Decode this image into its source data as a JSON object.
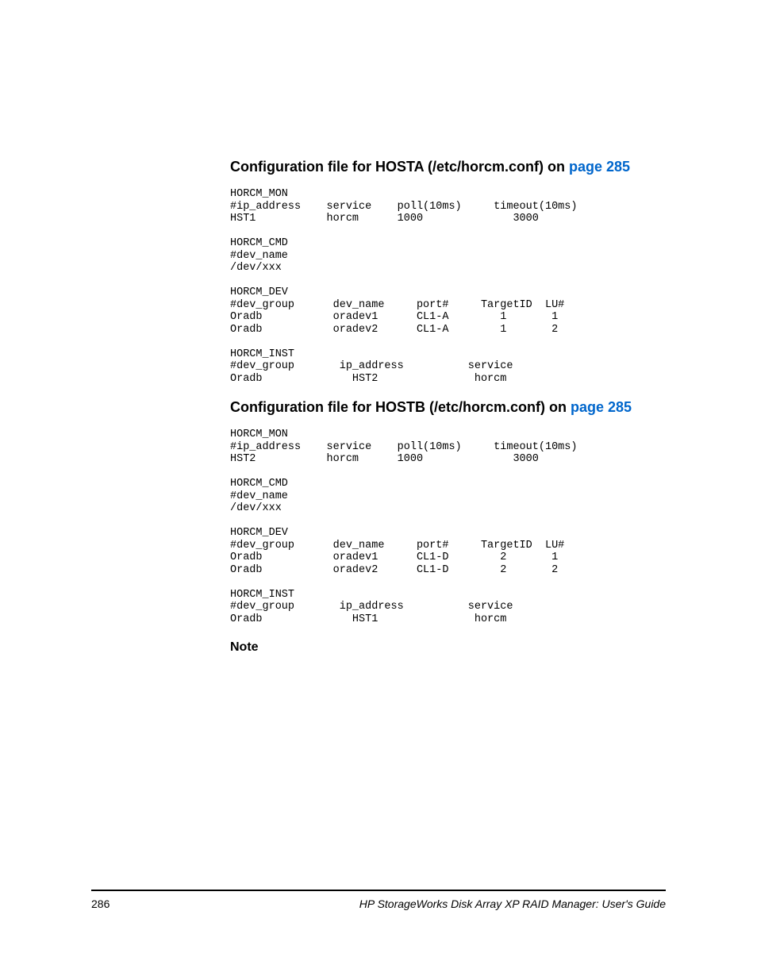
{
  "sectionA": {
    "title_prefix": "Configuration file for HOSTA (/etc/horcm.conf) on ",
    "title_link": "page 285",
    "block": "HORCM_MON\n#ip_address    service    poll(10ms)     timeout(10ms)\nHST1           horcm      1000              3000\n\nHORCM_CMD\n#dev_name\n/dev/xxx\n\nHORCM_DEV\n#dev_group      dev_name     port#     TargetID  LU#\nOradb           oradev1      CL1-A        1       1\nOradb           oradev2      CL1-A        1       2\n\nHORCM_INST\n#dev_group       ip_address          service\nOradb              HST2               horcm"
  },
  "sectionB": {
    "title_prefix": "Configuration file for HOSTB (/etc/horcm.conf) on ",
    "title_link": "page 285",
    "block": "HORCM_MON\n#ip_address    service    poll(10ms)     timeout(10ms)\nHST2           horcm      1000              3000\n\nHORCM_CMD\n#dev_name\n/dev/xxx\n\nHORCM_DEV\n#dev_group      dev_name     port#     TargetID  LU#\nOradb           oradev1      CL1-D        2       1\nOradb           oradev2      CL1-D        2       2\n\nHORCM_INST\n#dev_group       ip_address          service\nOradb              HST1               horcm"
  },
  "note": "Note",
  "footer": {
    "page": "286",
    "title": "HP StorageWorks Disk Array XP RAID Manager: User's Guide"
  }
}
